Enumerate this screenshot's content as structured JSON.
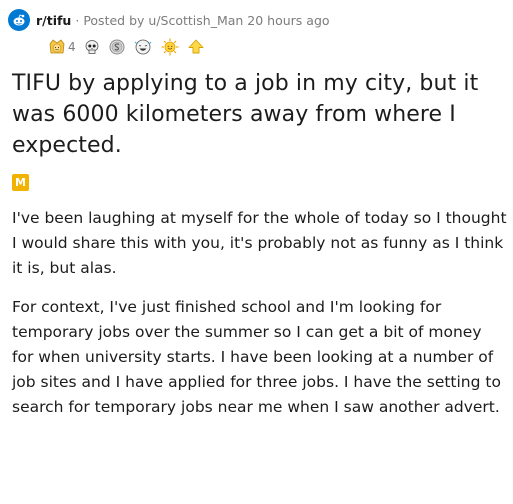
{
  "post": {
    "subreddit": "r/tifu",
    "separator": "·",
    "posted_by_prefix": "Posted by",
    "author": "u/Scottish_Man",
    "time": "20 hours ago",
    "awards": [
      {
        "icon": "wholesome-award-icon",
        "count": "4"
      },
      {
        "icon": "skull-award-icon",
        "count": ""
      },
      {
        "icon": "silver-award-icon",
        "count": ""
      },
      {
        "icon": "laughing-face-award-icon",
        "count": ""
      },
      {
        "icon": "sun-face-award-icon",
        "count": ""
      },
      {
        "icon": "upvote-award-icon",
        "count": ""
      }
    ],
    "title": "TIFU by applying to a job in my city, but it was 6000 kilometers away from where I expected.",
    "flair": "M",
    "paragraphs": [
      "I've been laughing at myself for the whole of today so I thought I would share this with you, it's probably not as funny as I think it is, but alas.",
      "For context, I've just finished school and I'm looking for temporary jobs over the summer so I can get a bit of money for when university starts. I have been looking at a number of job sites and I have applied for three jobs. I have the setting to search for temporary jobs near me when I saw another advert."
    ]
  },
  "colors": {
    "subreddit_icon": "#0079d3",
    "flair": "#f2b300",
    "meta_text": "#7c7c7c",
    "text": "#1c1c1c"
  }
}
